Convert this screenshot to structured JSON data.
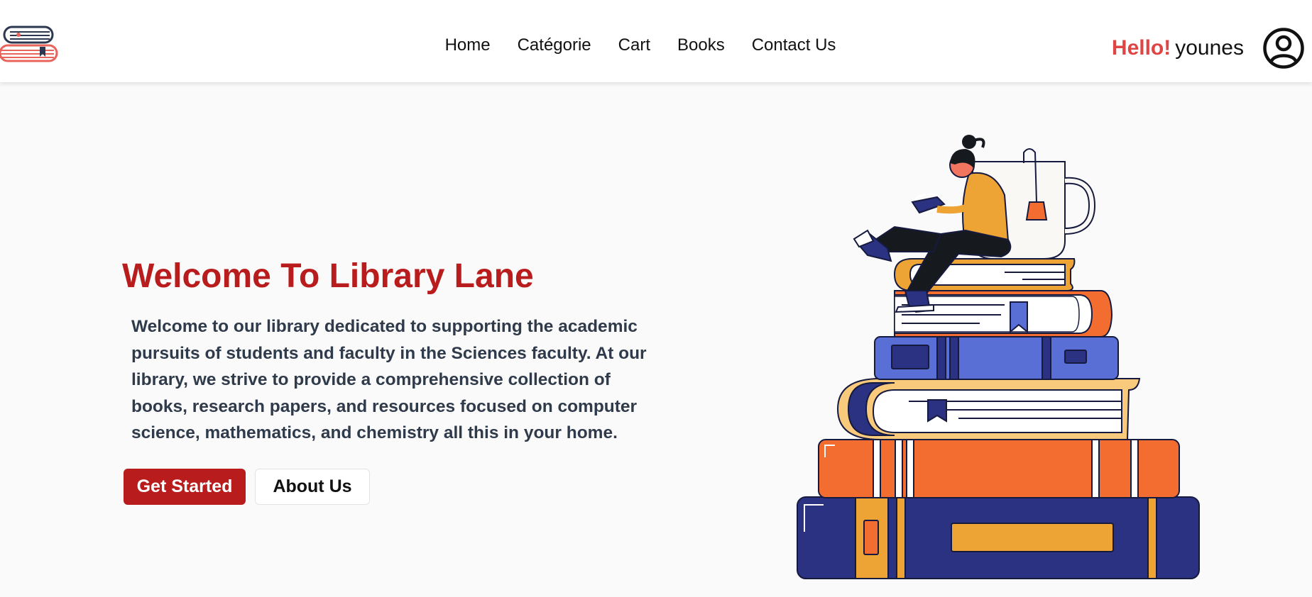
{
  "nav": {
    "logo_icon": "books-stack-logo",
    "links": [
      "Home",
      "Catégorie",
      "Cart",
      "Books",
      "Contact Us"
    ],
    "greeting_hello": "Hello!",
    "username": "younes",
    "avatar_icon": "user-circle-icon"
  },
  "hero": {
    "title": "Welcome To Library Lane",
    "description": "Welcome to our library dedicated to supporting the academic pursuits of students and faculty in the Sciences faculty. At our library, we strive to provide a comprehensive collection of books, research papers, and resources focused on computer science, mathematics, and chemistry all this in your home.",
    "primary_button": "Get Started",
    "secondary_button": "About Us",
    "illustration": "person-reading-on-book-stack"
  },
  "colors": {
    "accent": "#b91c1c",
    "hello": "#e04545",
    "text_dark": "#2f3a4a",
    "navy": "#2b3281",
    "orange": "#f46d30",
    "blue": "#5a6fd6",
    "yellow": "#eea434"
  }
}
